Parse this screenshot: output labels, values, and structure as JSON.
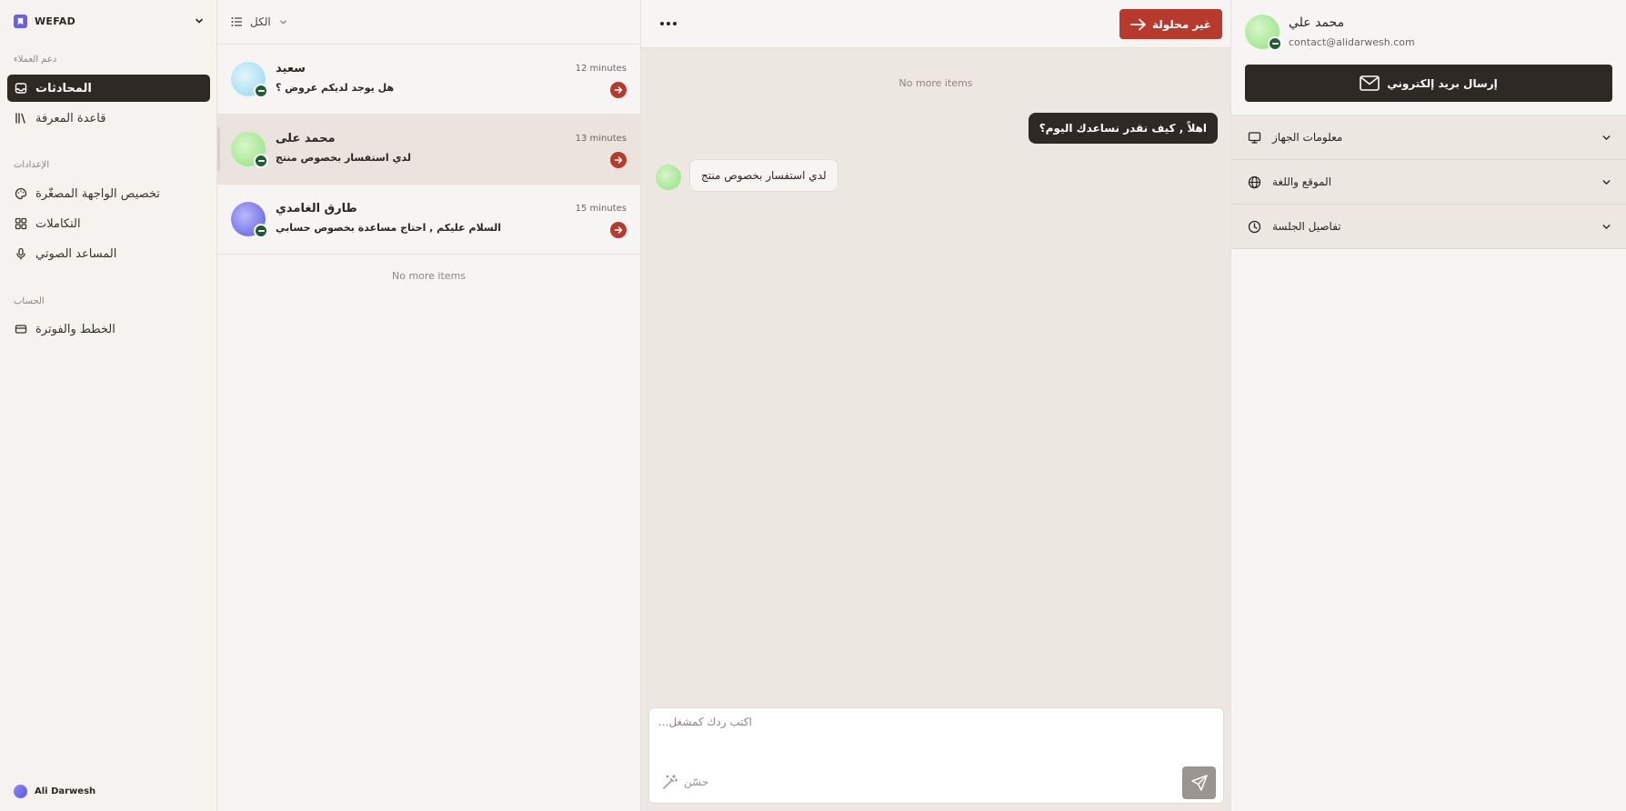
{
  "sidebar": {
    "brand": "WEFAD",
    "sections": {
      "support": "دعم العملاء",
      "settings": "الإعدادات",
      "account": "الحساب"
    },
    "items": [
      {
        "label": "المحادثات",
        "icon": "inbox-icon",
        "active": true
      },
      {
        "label": "قاعدة المعرفة",
        "icon": "library-icon",
        "active": false
      },
      {
        "label": "تخصيص الواجهة المصغّرة",
        "icon": "palette-icon",
        "active": false
      },
      {
        "label": "التكاملات",
        "icon": "grid-icon",
        "active": false
      },
      {
        "label": "المساعد الصوتي",
        "icon": "microphone-icon",
        "active": false
      },
      {
        "label": "الخطط والفوترة",
        "icon": "credit-card-icon",
        "active": false
      }
    ],
    "user": "Ali Darwesh"
  },
  "list": {
    "filter_label": "الكل",
    "conversations": [
      {
        "name": "سعيد",
        "preview": "هل يوجد لديكم عروض ؟",
        "time": "12 minutes"
      },
      {
        "name": "محمد على",
        "preview": "لدي استفسار بخصوص منتج",
        "time": "13 minutes"
      },
      {
        "name": "طارق الغامدي",
        "preview": "السلام عليكم , احتاج مساعدة بخصوص حسابي",
        "time": "15 minutes"
      }
    ],
    "no_more": "No more items"
  },
  "chat": {
    "status_label": "غير محلولة",
    "no_more": "No more items",
    "agent_message": "اهلاً , كيف نقدر نساعدك اليوم؟",
    "user_message": "لدي استفسار بخصوص منتج",
    "composer_placeholder": "اكتب ردك كمشغل...",
    "refine_label": "حسّن"
  },
  "contact": {
    "name": "محمد علي",
    "email": "contact@alidarwesh.com",
    "email_button": "إرسال بريد إلكتروني",
    "sections": [
      {
        "label": "معلومات الجهاز",
        "icon": "monitor-icon"
      },
      {
        "label": "الموقع واللغة",
        "icon": "globe-icon"
      },
      {
        "label": "تفاصيل الجلسة",
        "icon": "clock-icon"
      }
    ]
  },
  "colors": {
    "accent_red": "#b73a2d",
    "dark": "#2f2925",
    "brand_purple": "#6d5ee8"
  }
}
